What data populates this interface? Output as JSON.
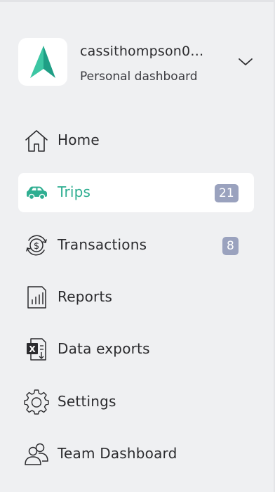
{
  "account": {
    "name": "cassithompson0…",
    "subtitle": "Personal dashboard"
  },
  "colors": {
    "accent": "#2fae91",
    "badge": "#9aa2be",
    "background": "#eff0f2"
  },
  "nav": {
    "items": [
      {
        "label": "Home",
        "icon": "home-icon"
      },
      {
        "label": "Trips",
        "icon": "car-icon",
        "badge": "21",
        "active": true
      },
      {
        "label": "Transactions",
        "icon": "dollar-cycle-icon",
        "badge": "8"
      },
      {
        "label": "Reports",
        "icon": "report-chart-icon"
      },
      {
        "label": "Data exports",
        "icon": "excel-export-icon"
      },
      {
        "label": "Settings",
        "icon": "gear-icon"
      },
      {
        "label": "Team Dashboard",
        "icon": "team-icon"
      }
    ]
  }
}
